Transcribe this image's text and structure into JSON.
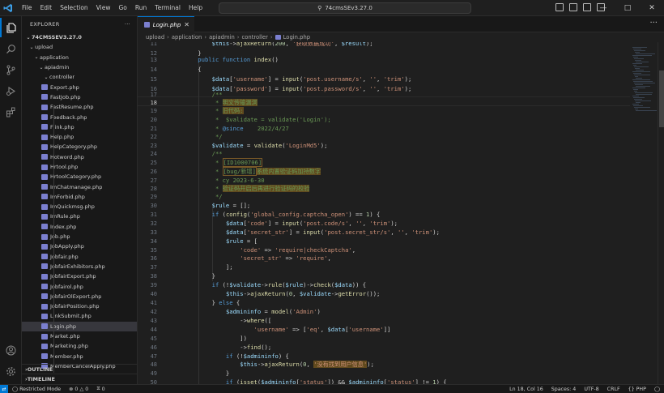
{
  "titlebar": {
    "menu": [
      "File",
      "Edit",
      "Selection",
      "View",
      "Go",
      "Run",
      "Terminal",
      "Help"
    ],
    "search_text": "74cmsSEv3.27.0"
  },
  "sidebar": {
    "title": "EXPLORER",
    "project": "74CMSSEV3.27.0",
    "folders": [
      "upload",
      "application",
      "apiadmin",
      "controller"
    ],
    "files": [
      "Export.php",
      "FastJob.php",
      "FastResume.php",
      "Feedback.php",
      "Flink.php",
      "Help.php",
      "HelpCategory.php",
      "Hotword.php",
      "Hrtool.php",
      "HrtoolCategory.php",
      "ImChatmanage.php",
      "ImForbid.php",
      "ImQuickmsg.php",
      "ImRule.php",
      "Index.php",
      "Job.php",
      "JobApply.php",
      "Jobfair.php",
      "JobfairExhibitors.php",
      "JobfairExport.php",
      "Jobfairol.php",
      "JobfairOlExport.php",
      "JobfairPosition.php",
      "LinkSubmit.php",
      "Login.php",
      "Market.php",
      "Marketing.php",
      "Member.php",
      "MemberCancelApply.php"
    ],
    "selected_file": "Login.php",
    "outline": "OUTLINE",
    "timeline": "TIMELINE"
  },
  "tab": {
    "label": "Login.php"
  },
  "breadcrumb": [
    "upload",
    "application",
    "apiadmin",
    "controller",
    "Login.php"
  ],
  "editor": {
    "line_numbers": [
      "11",
      "12",
      "13",
      "14",
      "15",
      "16",
      "17",
      "18",
      "19",
      "20",
      "21",
      "22",
      "23",
      "24",
      "25",
      "26",
      "27",
      "28",
      "29",
      "30",
      "31",
      "32",
      "33",
      "34",
      "35",
      "36",
      "37",
      "38",
      "39",
      "40",
      "41",
      "42",
      "43",
      "44",
      "45",
      "46",
      "47",
      "48",
      "49",
      "50"
    ],
    "current_line": "18"
  },
  "statusbar": {
    "mode": "Restricted Mode",
    "errors": "0",
    "warnings": "0",
    "ports": "0",
    "position": "Ln 18, Col 16",
    "spaces": "Spaces: 4",
    "encoding": "UTF-8",
    "eol": "CRLF",
    "language": "PHP"
  },
  "colors": {
    "accent": "#0078d4",
    "keyword": "#569cd6",
    "string": "#ce9178",
    "comment": "#6a9955",
    "function": "#dcdcaa",
    "variable": "#9cdcfe"
  }
}
